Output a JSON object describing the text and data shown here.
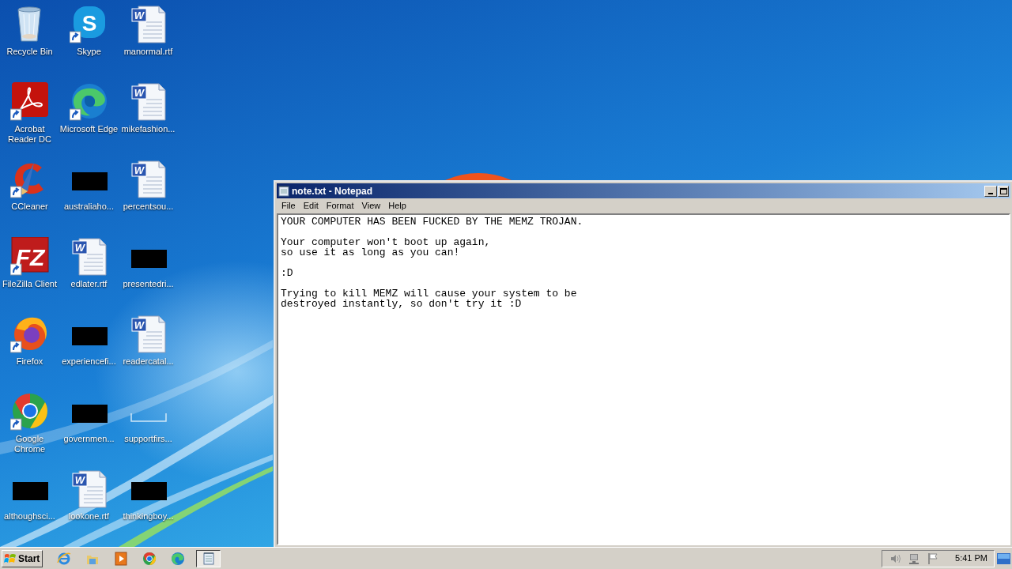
{
  "desktop": {
    "icons": [
      {
        "label": [
          "Recycle Bin"
        ],
        "kind": "recycle",
        "shortcut": false
      },
      {
        "label": [
          "Skype"
        ],
        "kind": "skype",
        "badge": "S",
        "shortcut": true
      },
      {
        "label": [
          "manormal.rtf"
        ],
        "kind": "word",
        "badge": "W",
        "shortcut": false
      },
      {
        "label": [
          "Acrobat",
          "Reader DC"
        ],
        "kind": "acrobat",
        "shortcut": true
      },
      {
        "label": [
          "Microsoft Edge"
        ],
        "kind": "edge",
        "shortcut": true
      },
      {
        "label": [
          "mikefashion..."
        ],
        "kind": "word",
        "badge": "W",
        "shortcut": false
      },
      {
        "label": [
          "CCleaner"
        ],
        "kind": "ccleaner",
        "shortcut": true
      },
      {
        "label": [
          "australiaho..."
        ],
        "kind": "redacted",
        "shortcut": false
      },
      {
        "label": [
          "percentsou..."
        ],
        "kind": "word",
        "badge": "W",
        "shortcut": false
      },
      {
        "label": [
          "FileZilla Client"
        ],
        "kind": "filezilla",
        "badge": "FZ",
        "shortcut": true
      },
      {
        "label": [
          "edlater.rtf"
        ],
        "kind": "word",
        "badge": "W",
        "shortcut": false
      },
      {
        "label": [
          "presentedri..."
        ],
        "kind": "redacted",
        "shortcut": false
      },
      {
        "label": [
          "Firefox"
        ],
        "kind": "firefox",
        "shortcut": true
      },
      {
        "label": [
          "experiencefi..."
        ],
        "kind": "redacted",
        "shortcut": false
      },
      {
        "label": [
          "readercatal..."
        ],
        "kind": "word",
        "badge": "W",
        "shortcut": false
      },
      {
        "label": [
          "Google",
          "Chrome"
        ],
        "kind": "chrome",
        "shortcut": true
      },
      {
        "label": [
          "governmen..."
        ],
        "kind": "redacted",
        "shortcut": false
      },
      {
        "label": [
          "supportfirs..."
        ],
        "kind": "blank",
        "shortcut": false
      },
      {
        "label": [
          "althoughsci..."
        ],
        "kind": "redacted",
        "shortcut": false
      },
      {
        "label": [
          "lookone.rtf"
        ],
        "kind": "word",
        "badge": "W",
        "shortcut": false
      },
      {
        "label": [
          "thinkingboy..."
        ],
        "kind": "redacted",
        "shortcut": false
      }
    ]
  },
  "notepad": {
    "title": "note.txt - Notepad",
    "menu": [
      "File",
      "Edit",
      "Format",
      "View",
      "Help"
    ],
    "paragraphs": [
      [
        "YOUR COMPUTER HAS BEEN FUCKED BY THE MEMZ TROJAN."
      ],
      [
        "Your computer won't boot up again,",
        "so use it as long as you can!"
      ],
      [
        ":D"
      ],
      [
        "Trying to kill MEMZ will cause your system to be",
        "destroyed instantly, so don't try it :D"
      ]
    ]
  },
  "taskbar": {
    "start": "Start",
    "quick_launch": [
      {
        "kind": "ie"
      },
      {
        "kind": "folder"
      },
      {
        "kind": "media"
      },
      {
        "kind": "chrome"
      },
      {
        "kind": "edge"
      }
    ],
    "tasks": [
      {
        "kind": "notepad",
        "selected": true
      }
    ],
    "tray": {
      "icons": [
        {
          "kind": "volume"
        },
        {
          "kind": "network"
        },
        {
          "kind": "flag"
        }
      ],
      "time": "5:41 PM"
    }
  }
}
